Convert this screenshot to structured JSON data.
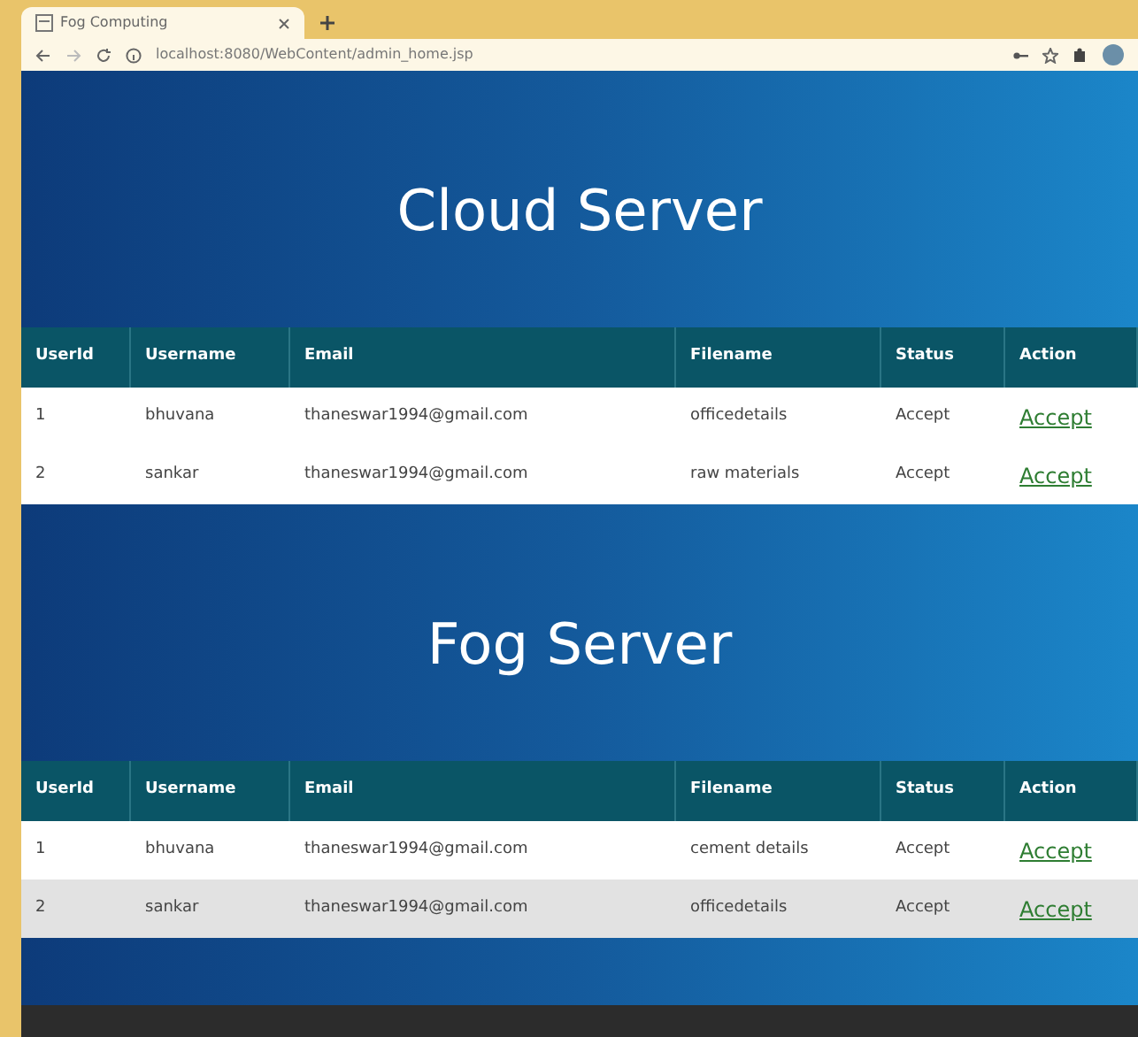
{
  "browser": {
    "tab_title": "Fog Computing",
    "url": "localhost:8080/WebContent/admin_home.jsp"
  },
  "sections": [
    {
      "title": "Cloud Server",
      "columns": [
        "UserId",
        "Username",
        "Email",
        "Filename",
        "Status",
        "Action"
      ],
      "rows": [
        {
          "cells": [
            "1",
            "bhuvana",
            "thaneswar1994@gmail.com",
            "officedetails",
            "Accept"
          ],
          "action": "Accept",
          "selected": false
        },
        {
          "cells": [
            "2",
            "sankar",
            "thaneswar1994@gmail.com",
            "raw materials",
            "Accept"
          ],
          "action": "Accept",
          "selected": false
        }
      ]
    },
    {
      "title": "Fog Server",
      "columns": [
        "UserId",
        "Username",
        "Email",
        "Filename",
        "Status",
        "Action"
      ],
      "rows": [
        {
          "cells": [
            "1",
            "bhuvana",
            "thaneswar1994@gmail.com",
            "cement details",
            "Accept"
          ],
          "action": "Accept",
          "selected": false
        },
        {
          "cells": [
            "2",
            "sankar",
            "thaneswar1994@gmail.com",
            "officedetails",
            "Accept"
          ],
          "action": "Accept",
          "selected": true
        }
      ]
    }
  ]
}
